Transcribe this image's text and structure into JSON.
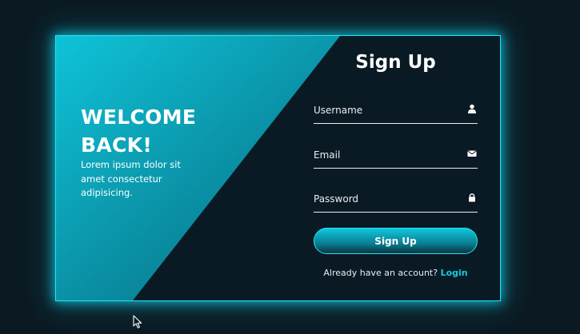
{
  "welcome": {
    "heading_line1": "WELCOME",
    "heading_line2": "BACK!",
    "description": "Lorem ipsum dolor sit amet consectetur adipisicing."
  },
  "form": {
    "title": "Sign Up",
    "username_placeholder": "Username",
    "email_placeholder": "Email",
    "password_placeholder": "Password",
    "submit_label": "Sign Up",
    "switch_text": "Already have an account?",
    "switch_link": "Login"
  },
  "icons": {
    "username": "user-icon",
    "email": "envelope-icon",
    "password": "lock-icon",
    "pointer": "mouse-cursor-icon"
  },
  "colors": {
    "background": "#0b1a22",
    "panel": "#0a1a24",
    "accent": "#1ee7f8",
    "gradient_start": "#0fc3d8",
    "gradient_end": "#0a4f62",
    "link": "#16c9e0"
  }
}
